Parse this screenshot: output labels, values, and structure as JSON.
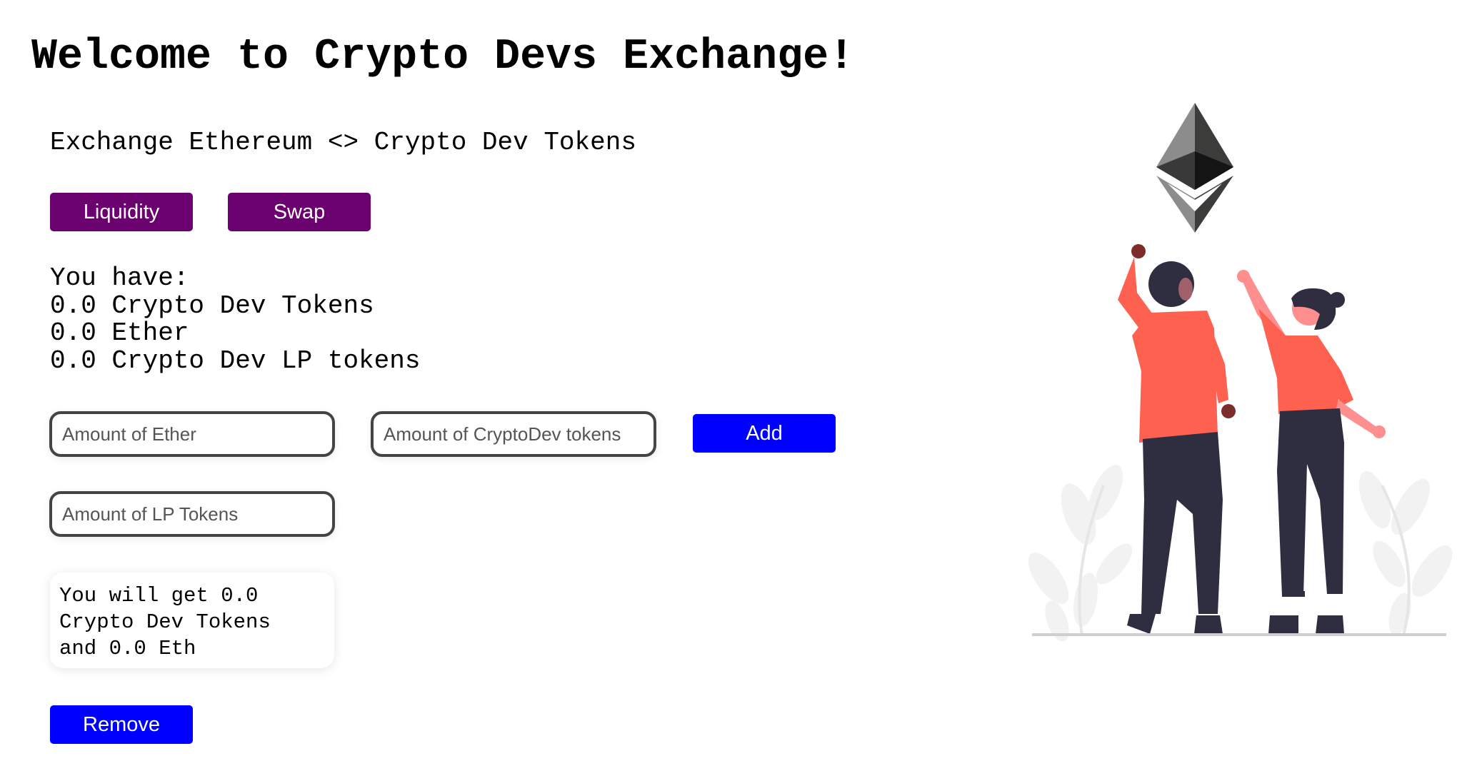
{
  "header": {
    "title": "Welcome to Crypto Devs Exchange!",
    "subtitle": "Exchange Ethereum <> Crypto Dev Tokens"
  },
  "tabs": {
    "liquidity_label": "Liquidity",
    "swap_label": "Swap"
  },
  "balances": {
    "heading": "You have:",
    "crypto_dev_tokens": "0.0 Crypto Dev Tokens",
    "ether": "0.0 Ether",
    "lp_tokens": "0.0 Crypto Dev LP tokens"
  },
  "add_liquidity": {
    "ether_placeholder": "Amount of Ether",
    "cd_tokens_placeholder": "Amount of CryptoDev tokens",
    "add_label": "Add"
  },
  "remove_liquidity": {
    "lp_placeholder": "Amount of LP Tokens",
    "you_will_get_line1": "You will get 0.0",
    "you_will_get_line2": "Crypto Dev Tokens",
    "you_will_get_line3": "and 0.0 Eth",
    "remove_label": "Remove"
  },
  "colors": {
    "tab_button": "#6b006f",
    "action_button": "#0000ff",
    "shirt": "#ff6150",
    "pants": "#2f2e41",
    "leaf": "#f2f2f2"
  },
  "illustration": {
    "icon": "ethereum-icon",
    "scene": "two-people-reaching-illustration"
  }
}
